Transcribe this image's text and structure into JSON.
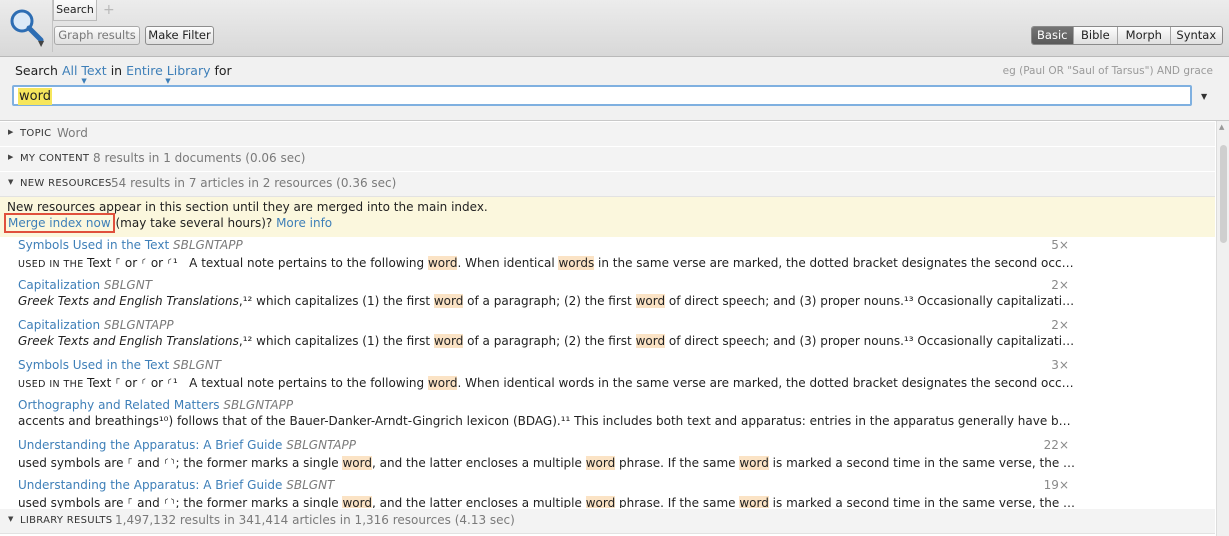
{
  "tabs": {
    "active": "Search",
    "add": "+"
  },
  "toolbar": {
    "graph_results": "Graph results",
    "make_filter": "Make Filter"
  },
  "search_kinds": [
    "Basic",
    "Bible",
    "Morph",
    "Syntax"
  ],
  "query": {
    "search_word": "Search",
    "scope_text": "All Text",
    "in_word": "in",
    "scope_library": "Entire Library",
    "for_word": "for",
    "hint": "eg (Paul OR \"Saul of Tarsus\") AND grace",
    "value": "word"
  },
  "sections": {
    "topic": {
      "label": "TOPIC",
      "text": "Word"
    },
    "my_content": {
      "label": "MY CONTENT",
      "text": "8 results in 1 documents (0.06 sec)"
    },
    "new_resources": {
      "label": "NEW RESOURCES",
      "text": "54 results in 7 articles in 2 resources (0.36 sec)"
    },
    "library_results": {
      "label": "LIBRARY RESULTS",
      "text": "1,497,132 results in 341,414 articles in 1,316 resources (4.13 sec)"
    }
  },
  "notice": {
    "line1": "New resources appear in this section until they are merged into the main index.",
    "merge": "Merge index now",
    "middle": " (may take several hours)? ",
    "more": "More info"
  },
  "results": [
    {
      "title": "Symbols Used in the Text",
      "resource": "SBLGNTAPP",
      "count": "5×",
      "snippet": "used in the Text ⸀ or ⸂ or ⸂¹   A textual note pertains to the following word. When identical words in the same verse are marked, the dotted bracket designates the second occurrence. Third..."
    },
    {
      "title": "Capitalization",
      "resource": "SBLGNT",
      "count": "2×",
      "snippet": "Greek Texts and English Translations,¹² which capitalizes (1) the first word of a paragraph; (2) the first word of direct speech; and (3) proper nouns.¹³ Occasionally capitalization in a..."
    },
    {
      "title": "Capitalization",
      "resource": "SBLGNTAPP",
      "count": "2×",
      "snippet": "Greek Texts and English Translations,¹² which capitalizes (1) the first word of a paragraph; (2) the first word of direct speech; and (3) proper nouns.¹³ Occasionally capitalization in a..."
    },
    {
      "title": "Symbols Used in the Text",
      "resource": "SBLGNT",
      "count": "3×",
      "snippet": "used in the Text ⸀ or ⸂ or ⸂¹   A textual note pertains to the following word. When identical words in the same verse are marked, the dotted bracket designates the second occurrence. Third..."
    },
    {
      "title": "Orthography and Related Matters",
      "resource": "SBLGNTAPP",
      "count": "",
      "snippet": "accents and breathings¹⁰) follows that of the Bauer-Danker-Arndt-Gingrich lexicon (BDAG).¹¹ This includes both text and apparatus: entries in the apparatus generally have been conformed to..."
    },
    {
      "title": "Understanding the Apparatus: A Brief Guide",
      "resource": "SBLGNTAPP",
      "count": "22×",
      "snippet": "used symbols are ⸀ and ⸂⸃; the former marks a single word, and the latter encloses a multiple word phrase. If the same word is marked a second time in the same verse, the ⸀ symbol is..."
    },
    {
      "title": "Understanding the Apparatus: A Brief Guide",
      "resource": "SBLGNT",
      "count": "19×",
      "snippet": "used symbols are ⸀ and ⸂⸃; the former marks a single word, and the latter encloses a multiple word phrase. If the same word is marked a second time in the same verse, the ⸀ symbol is..."
    }
  ],
  "colors": {
    "link": "#3e7fb8",
    "highlight": "#fbe3c5",
    "query_highlight": "#f6e65c",
    "merge_outline": "#e0503d"
  }
}
